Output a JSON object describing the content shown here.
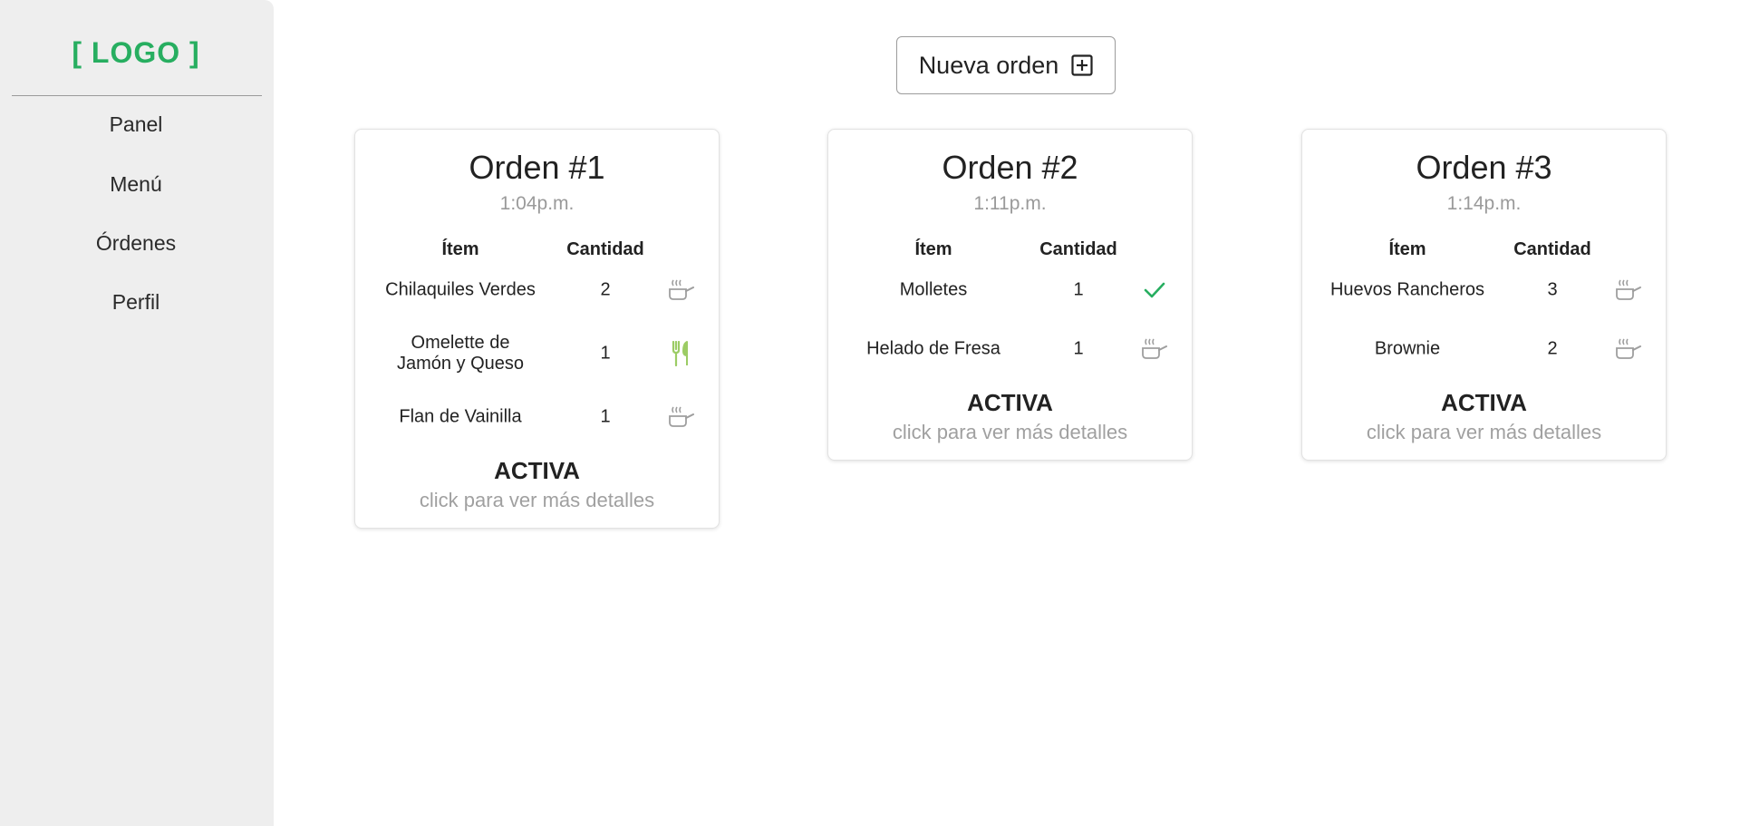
{
  "brand": {
    "logo": "[ LOGO ]",
    "color": "#27ae60"
  },
  "sidebar": {
    "items": [
      {
        "label": "Panel",
        "active": false
      },
      {
        "label": "Menú",
        "active": false
      },
      {
        "label": "Órdenes",
        "active": true
      },
      {
        "label": "Perfil",
        "active": false
      }
    ]
  },
  "toolbar": {
    "new_order_label": "Nueva orden",
    "new_order_icon": "plus-square-icon"
  },
  "table_headers": {
    "item": "Ítem",
    "quantity": "Cantidad"
  },
  "status_icons": {
    "cooking": {
      "icon": "cooking-pan-icon",
      "color": "#9e9e9e"
    },
    "served": {
      "icon": "utensils-icon",
      "color": "#9ccc65"
    },
    "done": {
      "icon": "checkmark-icon",
      "color": "#27ae60"
    }
  },
  "orders": [
    {
      "title": "Orden #1",
      "time": "1:04p.m.",
      "items": [
        {
          "name": "Chilaquiles Verdes",
          "qty": "2",
          "status": "cooking"
        },
        {
          "name": "Omelette de Jamón y Queso",
          "qty": "1",
          "status": "served"
        },
        {
          "name": "Flan de Vainilla",
          "qty": "1",
          "status": "cooking"
        }
      ],
      "status": "ACTIVA",
      "hint": "click para ver más detalles"
    },
    {
      "title": "Orden #2",
      "time": "1:11p.m.",
      "items": [
        {
          "name": "Molletes",
          "qty": "1",
          "status": "done"
        },
        {
          "name": "Helado de Fresa",
          "qty": "1",
          "status": "cooking"
        }
      ],
      "status": "ACTIVA",
      "hint": "click para ver más detalles"
    },
    {
      "title": "Orden #3",
      "time": "1:14p.m.",
      "items": [
        {
          "name": "Huevos Rancheros",
          "qty": "3",
          "status": "cooking"
        },
        {
          "name": "Brownie",
          "qty": "2",
          "status": "cooking"
        }
      ],
      "status": "ACTIVA",
      "hint": "click para ver más detalles"
    }
  ]
}
